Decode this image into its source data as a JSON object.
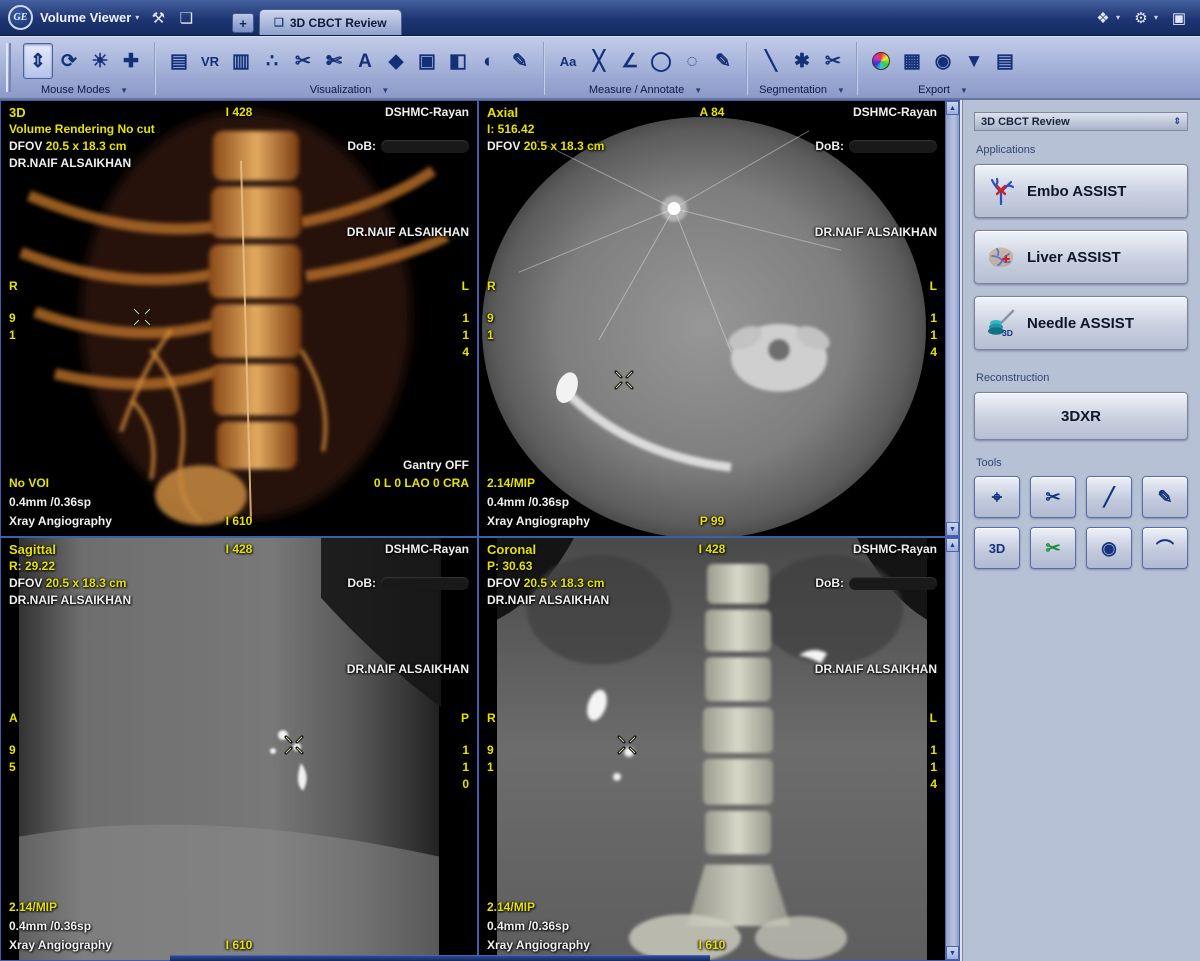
{
  "titlebar": {
    "logo_text": "GE",
    "app_name": "Volume Viewer",
    "left_icons": [
      {
        "name": "user-preferences-icon",
        "glyph": "⚒"
      },
      {
        "name": "export-image-icon",
        "glyph": "❏"
      }
    ],
    "new_tab_label": "+",
    "tab_label": "3D CBCT Review",
    "right_icons": [
      {
        "name": "displays-config-icon",
        "glyph": "❖",
        "caret": true
      },
      {
        "name": "settings-gear-icon",
        "glyph": "⚙",
        "caret": true
      },
      {
        "name": "capture-window-icon",
        "glyph": "▣",
        "caret": false
      }
    ]
  },
  "toolbar": {
    "groups": [
      {
        "label": "Mouse Modes",
        "items": [
          {
            "name": "scroll-mode-icon",
            "glyph": "⇕",
            "selected": true
          },
          {
            "name": "rotate-mode-icon",
            "glyph": "⟳"
          },
          {
            "name": "window-level-mode-icon",
            "glyph": "☀"
          },
          {
            "name": "pan-mode-icon",
            "glyph": "✚"
          }
        ]
      },
      {
        "label": "Visualization",
        "items": [
          {
            "name": "layout-icon",
            "glyph": "▤"
          },
          {
            "name": "volume-rendering-icon",
            "glyph": "VR"
          },
          {
            "name": "display-monitor-icon",
            "glyph": "▥"
          },
          {
            "name": "steps-icon",
            "glyph": "∴"
          },
          {
            "name": "cut-plane-left-icon",
            "glyph": "✂"
          },
          {
            "name": "cut-plane-right-icon",
            "glyph": "✄"
          },
          {
            "name": "annotation-a-icon",
            "glyph": "A"
          },
          {
            "name": "diamond-view-icon",
            "glyph": "◆"
          },
          {
            "name": "cube-view-icon",
            "glyph": "▣"
          },
          {
            "name": "slab-icon",
            "glyph": "◧"
          },
          {
            "name": "sphere-cut-icon",
            "glyph": "◐"
          },
          {
            "name": "paint-tool-icon",
            "glyph": "✎"
          }
        ]
      },
      {
        "label": "Measure / Annotate",
        "items": [
          {
            "name": "text-annotation-icon",
            "glyph": "Aa"
          },
          {
            "name": "measure-distance-icon",
            "glyph": "╳"
          },
          {
            "name": "measure-angle-icon",
            "glyph": "∠"
          },
          {
            "name": "ellipse-roi-icon",
            "glyph": "◯"
          },
          {
            "name": "freehand-roi-icon",
            "glyph": "◌"
          },
          {
            "name": "annotate-pencil-icon",
            "glyph": "✎"
          }
        ]
      },
      {
        "label": "Segmentation",
        "items": [
          {
            "name": "seed-point-icon",
            "glyph": "╲"
          },
          {
            "name": "auto-select-icon",
            "glyph": "✱"
          },
          {
            "name": "scissors-segment-icon",
            "glyph": "✂"
          }
        ]
      },
      {
        "label": "Export",
        "items": [
          {
            "name": "color-wheel-icon",
            "glyph": ""
          },
          {
            "name": "copy-series-icon",
            "glyph": "▦"
          },
          {
            "name": "camera-capture-icon",
            "glyph": "◉"
          },
          {
            "name": "save-image-icon",
            "glyph": "▼"
          },
          {
            "name": "print-icon",
            "glyph": "▤"
          }
        ]
      }
    ]
  },
  "scroll": {
    "up": "▲",
    "down": "▼"
  },
  "viewports": [
    {
      "title": "3D",
      "top_center": "I 428",
      "info": "Volume Rendering No cut",
      "dfov_label": "DFOV",
      "dfov_value": "20.5 x 18.3 cm",
      "physician": "DR.NAIF ALSAIKHAN",
      "facility": "DSHMC-Rayan",
      "dob_label": "DoB:",
      "physician_right": "DR.NAIF ALSAIKHAN",
      "left_letter": "R",
      "right_letter": "L",
      "left_numbers": [
        "9",
        "1"
      ],
      "right_numbers": [
        "1",
        "1",
        "4"
      ],
      "bottom1": "No VOI",
      "bottom2": "0.4mm /0.36sp",
      "bottom3": "Xray Angiography",
      "bottom_center": "I 610",
      "gantry_status": "Gantry OFF",
      "gantry_angles": "0 L 0 LAO 0 CRA"
    },
    {
      "title": "Axial",
      "top_center": "A 84",
      "info": "I: 516.42",
      "dfov_label": "DFOV",
      "dfov_value": "20.5 x 18.3 cm",
      "physician": "",
      "facility": "DSHMC-Rayan",
      "dob_label": "DoB:",
      "physician_right": "DR.NAIF ALSAIKHAN",
      "left_letter": "R",
      "right_letter": "L",
      "left_numbers": [
        "9",
        "1"
      ],
      "right_numbers": [
        "1",
        "1",
        "4"
      ],
      "bottom1": "2.14/MIP",
      "bottom2": "0.4mm /0.36sp",
      "bottom3": "Xray Angiography",
      "bottom_center": "P 99"
    },
    {
      "title": "Sagittal",
      "top_center": "I 428",
      "info": "R: 29.22",
      "dfov_label": "DFOV",
      "dfov_value": "20.5 x 18.3 cm",
      "physician": "DR.NAIF ALSAIKHAN",
      "facility": "DSHMC-Rayan",
      "dob_label": "DoB:",
      "physician_right": "DR.NAIF ALSAIKHAN",
      "left_letter": "A",
      "right_letter": "P",
      "left_numbers": [
        "9",
        "5"
      ],
      "right_numbers": [
        "1",
        "1",
        "0"
      ],
      "bottom1": "2.14/MIP",
      "bottom2": "0.4mm /0.36sp",
      "bottom3": "Xray Angiography",
      "bottom_center": "I 610"
    },
    {
      "title": "Coronal",
      "top_center": "I 428",
      "info": "P: 30.63",
      "dfov_label": "DFOV",
      "dfov_value": "20.5 x 18.3 cm",
      "physician": "DR.NAIF ALSAIKHAN",
      "facility": "DSHMC-Rayan",
      "dob_label": "DoB:",
      "physician_right": "DR.NAIF ALSAIKHAN",
      "left_letter": "R",
      "right_letter": "L",
      "left_numbers": [
        "9",
        "1"
      ],
      "right_numbers": [
        "1",
        "1",
        "4"
      ],
      "bottom1": "2.14/MIP",
      "bottom2": "0.4mm /0.36sp",
      "bottom3": "Xray Angiography",
      "bottom_center": "I 610"
    }
  ],
  "panel": {
    "title": "3D CBCT Review",
    "applications_label": "Applications",
    "applications": [
      {
        "label": "Embo ASSIST"
      },
      {
        "label": "Liver ASSIST"
      },
      {
        "label": "Needle ASSIST"
      }
    ],
    "reconstruction_label": "Reconstruction",
    "reconstruction": {
      "label": "3DXR"
    },
    "tools_label": "Tools",
    "tools": [
      {
        "name": "trajectory-tool-icon",
        "glyph": "⌖",
        "color": "#16337f"
      },
      {
        "name": "cut-tool-icon",
        "glyph": "✂",
        "color": "#16337f"
      },
      {
        "name": "line-tool-icon",
        "glyph": "╱",
        "color": "#16337f"
      },
      {
        "name": "pen-tool-icon",
        "glyph": "✎",
        "color": "#16337f"
      },
      {
        "name": "3d-stamp-tool-icon",
        "glyph": "3D",
        "color": "#16337f"
      },
      {
        "name": "green-scissors-tool-icon",
        "glyph": "✂",
        "color": "#1a8c3a"
      },
      {
        "name": "sphere-tool-icon",
        "glyph": "◉",
        "color": "#16337f"
      },
      {
        "name": "curve-tool-icon",
        "glyph": "⌒",
        "color": "#16337f"
      }
    ]
  }
}
